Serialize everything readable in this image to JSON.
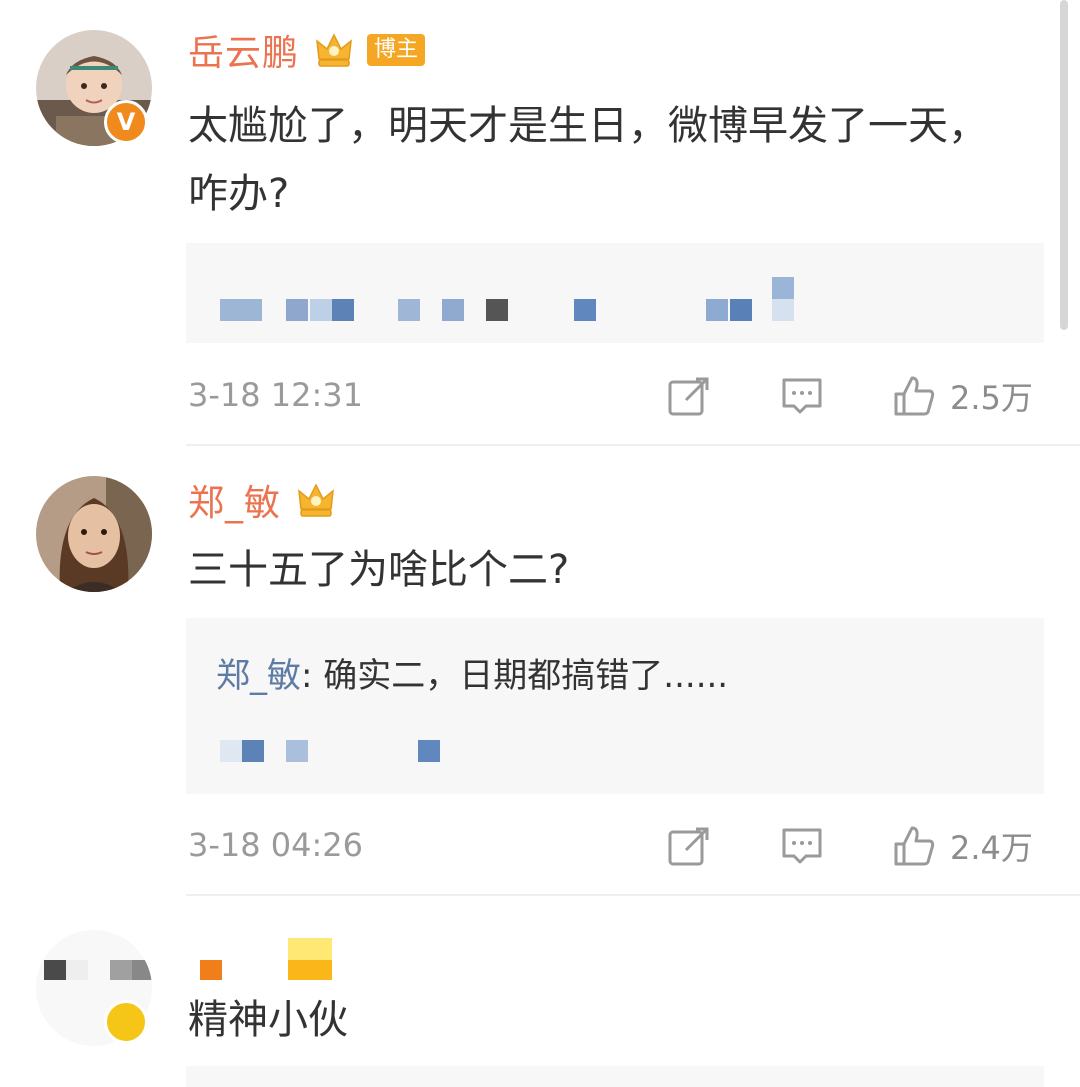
{
  "comments": [
    {
      "username": "岳云鹏",
      "tag": "博主",
      "avatar_badge": "V",
      "text": "太尴尬了，明天才是生日，微博早发了一天，咋办?",
      "time": "3-18 12:31",
      "likes": "2.5万"
    },
    {
      "username": "郑_敏",
      "text": "三十五了为啥比个二?",
      "reply": {
        "user": "郑_敏",
        "separator": ": ",
        "text": "确实二，日期都搞错了......"
      },
      "time": "3-18 04:26",
      "likes": "2.4万"
    },
    {
      "text": "精神小伙"
    }
  ],
  "icons": {
    "crown": "crown-icon",
    "repost": "repost-icon",
    "comment": "comment-icon",
    "like": "like-icon"
  },
  "colors": {
    "username": "#eb7350",
    "reply_user": "#5d7ca5",
    "meta": "#9a9a9a",
    "reply_bg": "#f7f7f7",
    "crown": "#f5b531",
    "blogger_tag": "#f5a623"
  }
}
